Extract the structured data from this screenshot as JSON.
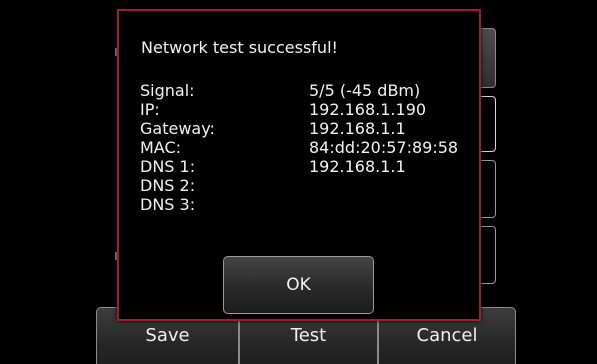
{
  "dialog": {
    "message": "Network test successful!",
    "fields": [
      {
        "label": "Signal:",
        "value": "5/5 (-45 dBm)"
      },
      {
        "label": "IP:",
        "value": "192.168.1.190"
      },
      {
        "label": "Gateway:",
        "value": "192.168.1.1"
      },
      {
        "label": "MAC:",
        "value": "84:dd:20:57:89:58"
      },
      {
        "label": "DNS 1:",
        "value": "192.168.1.1"
      },
      {
        "label": "DNS 2:",
        "value": ""
      },
      {
        "label": "DNS 3:",
        "value": ""
      }
    ],
    "ok_label": "OK",
    "border_color": "#a01e2c"
  },
  "bottom_bar": {
    "save_label": "Save",
    "test_label": "Test",
    "cancel_label": "Cancel"
  }
}
